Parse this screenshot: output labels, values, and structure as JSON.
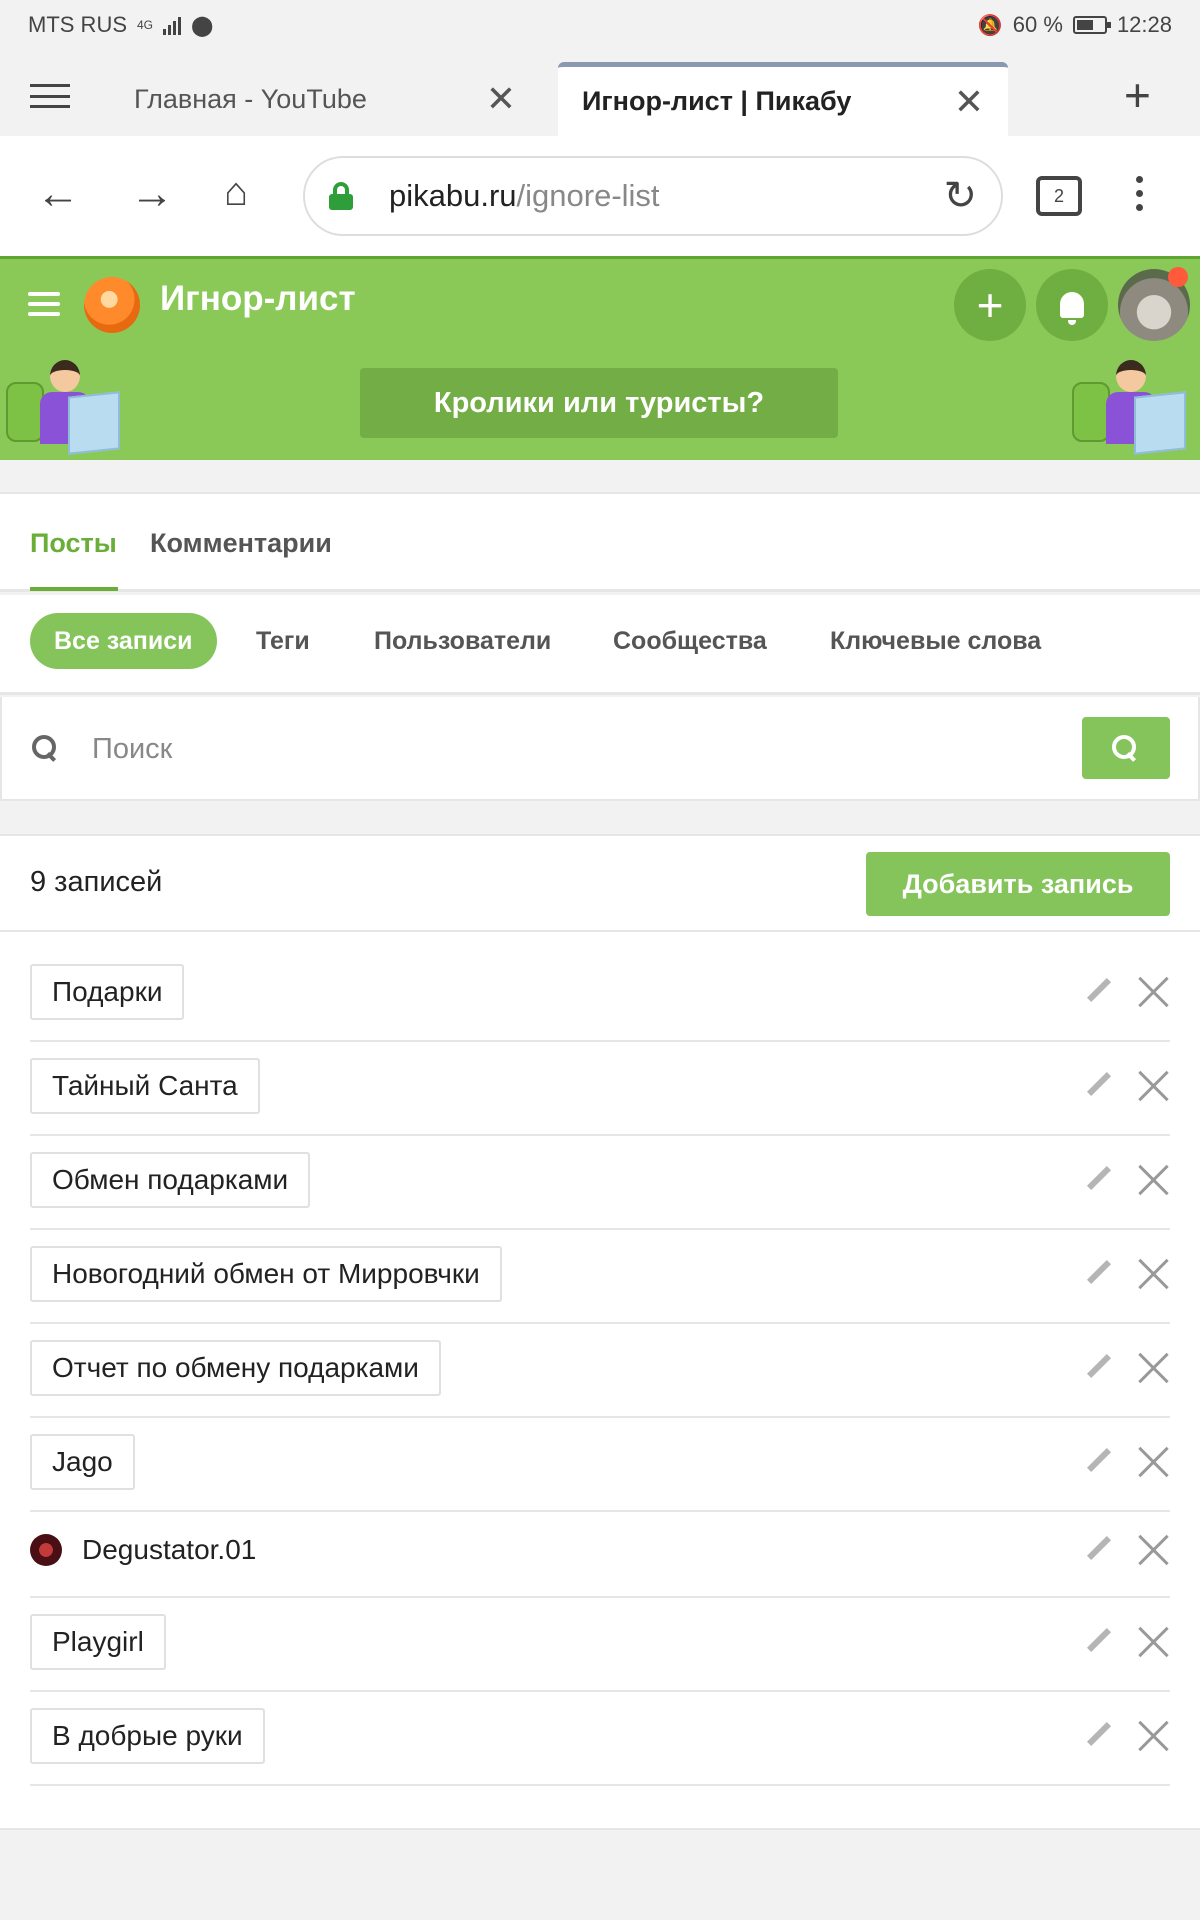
{
  "status": {
    "carrier": "MTS RUS",
    "net": "4G",
    "battery": "60 %",
    "time": "12:28"
  },
  "browser": {
    "tabs": [
      {
        "title": "Главная - YouTube",
        "active": false
      },
      {
        "title": "Игнор-лист | Пикабу",
        "active": true
      }
    ],
    "url_host": "pikabu.ru",
    "url_path": "/ignore-list",
    "tab_count": "2"
  },
  "site": {
    "title": "Игнор-лист",
    "banner_label": "Кролики или туристы?",
    "accent": "#8ac858",
    "button_green": "#84c45a"
  },
  "main_tabs": [
    {
      "label": "Посты",
      "active": true
    },
    {
      "label": "Комментарии",
      "active": false
    }
  ],
  "filters": [
    {
      "label": "Все записи",
      "active": true
    },
    {
      "label": "Теги",
      "active": false
    },
    {
      "label": "Пользователи",
      "active": false
    },
    {
      "label": "Сообщества",
      "active": false
    },
    {
      "label": "Ключевые слова",
      "active": false
    }
  ],
  "search": {
    "placeholder": "Поиск",
    "value": ""
  },
  "list": {
    "count_label": "9 записей",
    "add_label": "Добавить запись",
    "items": [
      {
        "type": "tag",
        "label": "Подарки"
      },
      {
        "type": "tag",
        "label": "Тайный Санта"
      },
      {
        "type": "tag",
        "label": "Обмен подарками"
      },
      {
        "type": "tag",
        "label": "Новогодний обмен от Мирровчки"
      },
      {
        "type": "tag",
        "label": "Отчет по обмену подарками"
      },
      {
        "type": "tag",
        "label": "Jago"
      },
      {
        "type": "user",
        "label": "Degustator.01"
      },
      {
        "type": "tag",
        "label": "Playgirl"
      },
      {
        "type": "tag",
        "label": "В добрые руки"
      }
    ]
  }
}
